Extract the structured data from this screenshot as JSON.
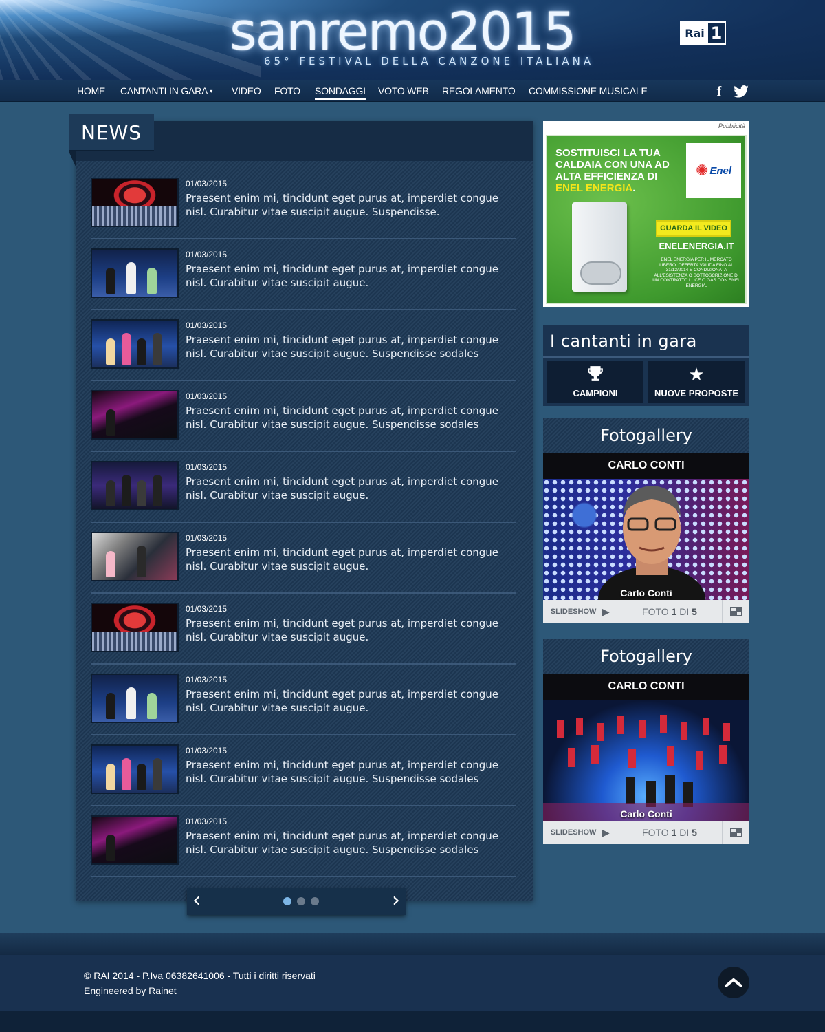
{
  "header": {
    "logo_main": "sanremo2015",
    "logo_sub": "65° FESTIVAL DELLA CANZONE ITALIANA",
    "broadcaster_logo": {
      "rai": "Rai",
      "channel": "1"
    }
  },
  "nav": {
    "items": [
      {
        "label": "HOME"
      },
      {
        "label": "CANTANTI IN GARA",
        "has_dropdown": true
      },
      {
        "label": "VIDEO"
      },
      {
        "label": "FOTO"
      },
      {
        "label": "SONDAGGI",
        "active": true
      },
      {
        "label": "VOTO WEB"
      },
      {
        "label": "REGOLAMENTO"
      },
      {
        "label": "COMMISSIONE MUSICALE"
      }
    ],
    "social": {
      "facebook_icon": "f",
      "twitter_icon": "twitter-bird"
    }
  },
  "news": {
    "title": "NEWS",
    "items": [
      {
        "date": "01/03/2015",
        "text": "Praesent enim mi, tincidunt eget purus at, imperdiet congue nisl. Curabitur vitae suscipit augue. Suspendisse.",
        "thumb": "stage"
      },
      {
        "date": "01/03/2015",
        "text": "Praesent enim mi, tincidunt eget purus at, imperdiet congue nisl. Curabitur vitae suscipit augue.",
        "thumb": "couple"
      },
      {
        "date": "01/03/2015",
        "text": "Praesent enim mi, tincidunt eget purus at, imperdiet congue nisl. Curabitur vitae suscipit augue. Suspendisse sodales",
        "thumb": "trio"
      },
      {
        "date": "01/03/2015",
        "text": "Praesent enim mi, tincidunt eget purus at, imperdiet congue nisl. Curabitur vitae suscipit augue. Suspendisse sodales",
        "thumb": "purple"
      },
      {
        "date": "01/03/2015",
        "text": "Praesent enim mi, tincidunt eget purus at, imperdiet congue nisl. Curabitur vitae suscipit augue.",
        "thumb": "band"
      },
      {
        "date": "01/03/2015",
        "text": "Praesent enim mi, tincidunt eget purus at, imperdiet congue nisl. Curabitur vitae suscipit augue.",
        "thumb": "mixed"
      },
      {
        "date": "01/03/2015",
        "text": "Praesent enim mi, tincidunt eget purus at, imperdiet congue nisl. Curabitur vitae suscipit augue.",
        "thumb": "stage"
      },
      {
        "date": "01/03/2015",
        "text": "Praesent enim mi, tincidunt eget purus at, imperdiet congue nisl. Curabitur vitae suscipit augue.",
        "thumb": "couple"
      },
      {
        "date": "01/03/2015",
        "text": "Praesent enim mi, tincidunt eget purus at, imperdiet congue nisl. Curabitur vitae suscipit augue. Suspendisse sodales",
        "thumb": "trio"
      },
      {
        "date": "01/03/2015",
        "text": "Praesent enim mi, tincidunt eget purus at, imperdiet congue nisl. Curabitur vitae suscipit augue. Suspendisse sodales",
        "thumb": "purple"
      }
    ],
    "pager": {
      "prev": "‹",
      "next": "›",
      "pages": 3,
      "current": 1
    }
  },
  "ad": {
    "label": "Pubblicità",
    "headline_1": "SOSTITUISCI LA TUA CALDAIA CON UNA AD ALTA EFFICIENZA DI ",
    "headline_2": "ENEL ENERGIA",
    "headline_3": ".",
    "brand": "Enel",
    "cta": "GUARDA IL VIDEO",
    "site": "ENELENERGIA.IT",
    "fine_print": "ENEL ENERGIA PER IL MERCATO LIBERO. OFFERTA VALIDA FINO AL 31/12/2014 E CONDIZIONATA ALL'ESISTENZA O SOTTOSCRIZIONE DI UN CONTRATTO LUCE O GAS CON ENEL ENERGIA."
  },
  "cantanti": {
    "title": "I cantanti in gara",
    "buttons": [
      {
        "label": "CAMPIONI",
        "icon": "trophy-icon"
      },
      {
        "label": "NUOVE PROPOSTE",
        "icon": "star-icon"
      }
    ]
  },
  "galleries": [
    {
      "title": "Fotogallery",
      "name": "CARLO CONTI",
      "caption": "Carlo Conti",
      "slideshow": "SLIDESHOW",
      "count_prefix": "FOTO ",
      "current": "1",
      "count_sep": " DI ",
      "total": "5"
    },
    {
      "title": "Fotogallery",
      "name": "CARLO CONTI",
      "caption": "Carlo Conti",
      "slideshow": "SLIDESHOW",
      "count_prefix": "FOTO ",
      "current": "1",
      "count_sep": " DI ",
      "total": "5"
    }
  ],
  "footer": {
    "copyright": "© RAI 2014 - P.Iva 06382641006 - Tutti i diritti riservati",
    "credits": "Engineered by Rainet"
  },
  "colors": {
    "page_bg": "#2d5878",
    "nav_bg": "#17365a",
    "panel_dark": "#162c45",
    "ad_green": "#3f9a2e",
    "ad_yellow": "#f4e51a"
  }
}
